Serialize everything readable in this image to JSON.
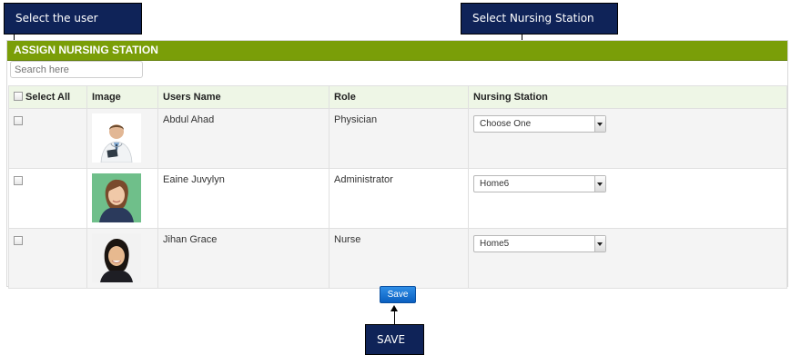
{
  "callouts": {
    "select_user": "Select the user",
    "select_station": "Select Nursing Station",
    "save": "SAVE"
  },
  "panel": {
    "title": "ASSIGN NURSING STATION",
    "search_placeholder": "Search here"
  },
  "table": {
    "headers": {
      "select_all": "Select All",
      "image": "Image",
      "users_name": "Users Name",
      "role": "Role",
      "nursing_station": "Nursing Station"
    },
    "rows": [
      {
        "name": "Abdul Ahad",
        "role": "Physician",
        "station": "Choose One",
        "checked": false
      },
      {
        "name": "Eaine Juvylyn",
        "role": "Administrator",
        "station": "Home6",
        "checked": false
      },
      {
        "name": "Jihan Grace",
        "role": "Nurse",
        "station": "Home5",
        "checked": false
      }
    ]
  },
  "actions": {
    "save_label": "Save"
  },
  "colors": {
    "header_green": "#7a9e08",
    "callout_navy": "#0f2358",
    "save_blue": "#0a5fc0"
  }
}
